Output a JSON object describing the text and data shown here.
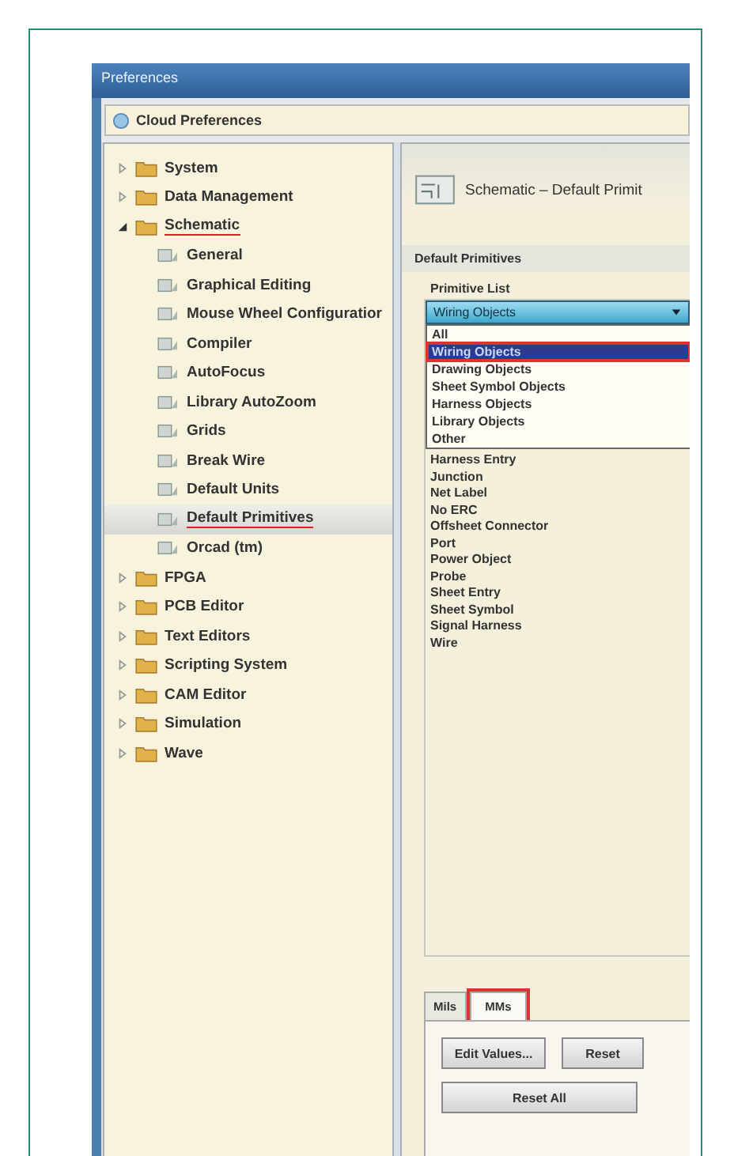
{
  "window": {
    "title": "Preferences"
  },
  "cloud_button": "Cloud Preferences",
  "tree": [
    {
      "label": "System",
      "kind": "folder",
      "expanded": false,
      "selected": false,
      "annotated": false
    },
    {
      "label": "Data Management",
      "kind": "folder",
      "expanded": false,
      "selected": false,
      "annotated": false
    },
    {
      "label": "Schematic",
      "kind": "folder",
      "expanded": true,
      "selected": false,
      "annotated": true,
      "children": [
        {
          "label": "General",
          "kind": "page",
          "selected": false,
          "annotated": false
        },
        {
          "label": "Graphical Editing",
          "kind": "page",
          "selected": false,
          "annotated": false
        },
        {
          "label": "Mouse Wheel Configuratior",
          "kind": "page",
          "selected": false,
          "annotated": false
        },
        {
          "label": "Compiler",
          "kind": "page",
          "selected": false,
          "annotated": false
        },
        {
          "label": "AutoFocus",
          "kind": "page",
          "selected": false,
          "annotated": false
        },
        {
          "label": "Library AutoZoom",
          "kind": "page",
          "selected": false,
          "annotated": false
        },
        {
          "label": "Grids",
          "kind": "page",
          "selected": false,
          "annotated": false
        },
        {
          "label": "Break Wire",
          "kind": "page",
          "selected": false,
          "annotated": false
        },
        {
          "label": "Default Units",
          "kind": "page",
          "selected": false,
          "annotated": false
        },
        {
          "label": "Default Primitives",
          "kind": "page",
          "selected": true,
          "annotated": true
        },
        {
          "label": "Orcad (tm)",
          "kind": "page",
          "selected": false,
          "annotated": false
        }
      ]
    },
    {
      "label": "FPGA",
      "kind": "folder",
      "expanded": false,
      "selected": false,
      "annotated": false
    },
    {
      "label": "PCB Editor",
      "kind": "folder",
      "expanded": false,
      "selected": false,
      "annotated": false
    },
    {
      "label": "Text Editors",
      "kind": "folder",
      "expanded": false,
      "selected": false,
      "annotated": false
    },
    {
      "label": "Scripting System",
      "kind": "folder",
      "expanded": false,
      "selected": false,
      "annotated": false
    },
    {
      "label": "CAM Editor",
      "kind": "folder",
      "expanded": false,
      "selected": false,
      "annotated": false
    },
    {
      "label": "Simulation",
      "kind": "folder",
      "expanded": false,
      "selected": false,
      "annotated": false
    },
    {
      "label": "Wave",
      "kind": "folder",
      "expanded": false,
      "selected": false,
      "annotated": false
    }
  ],
  "panel": {
    "title": "Schematic – Default Primit",
    "section": "Default Primitives",
    "list_label": "Primitive List",
    "combo_value": "Wiring Objects",
    "dropdown_options": [
      {
        "label": "All",
        "selected": false,
        "annotated": false
      },
      {
        "label": "Wiring Objects",
        "selected": true,
        "annotated": true
      },
      {
        "label": "Drawing Objects",
        "selected": false,
        "annotated": false
      },
      {
        "label": "Sheet Symbol Objects",
        "selected": false,
        "annotated": false
      },
      {
        "label": "Harness Objects",
        "selected": false,
        "annotated": false
      },
      {
        "label": "Library Objects",
        "selected": false,
        "annotated": false
      },
      {
        "label": "Other",
        "selected": false,
        "annotated": false
      }
    ],
    "primitives": [
      "Harness Entry",
      "Junction",
      "Net Label",
      "No ERC",
      "Offsheet Connector",
      "Port",
      "Power Object",
      "Probe",
      "Sheet Entry",
      "Sheet Symbol",
      "Signal Harness",
      "Wire"
    ],
    "tabs": [
      {
        "label": "Mils",
        "selected": false,
        "annotated": false
      },
      {
        "label": "MMs",
        "selected": true,
        "annotated": true
      }
    ],
    "buttons": [
      "Edit Values...",
      "Reset",
      "Reset All"
    ]
  }
}
